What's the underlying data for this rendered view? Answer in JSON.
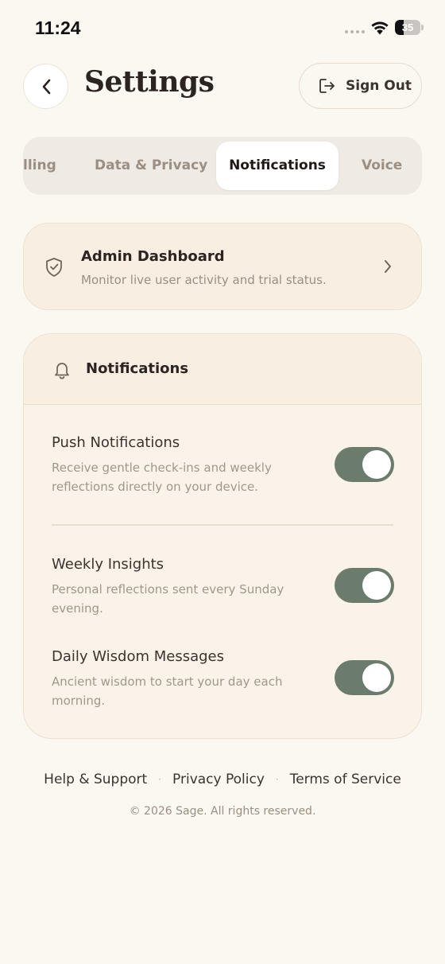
{
  "status_bar": {
    "time": "11:24",
    "battery_level": "35",
    "battery_fraction": 0.35,
    "icons": [
      "signal-dots-icon",
      "wifi-icon",
      "battery-icon"
    ]
  },
  "header": {
    "back_icon": "chevron-left-icon",
    "title": "Settings",
    "sign_out_label": "Sign Out",
    "sign_out_icon": "logout-icon"
  },
  "tabs": {
    "items": [
      {
        "label": "lling",
        "active": false
      },
      {
        "label": "Data & Privacy",
        "active": false
      },
      {
        "label": "Notifications",
        "active": true
      },
      {
        "label": "Voice",
        "active": false
      }
    ]
  },
  "admin_card": {
    "icon": "shield-check-icon",
    "title": "Admin Dashboard",
    "subtitle": "Monitor live user activity and trial status.",
    "chevron": "chevron-right-icon"
  },
  "notifications": {
    "icon": "bell-icon",
    "title": "Notifications",
    "settings": [
      {
        "title": "Push Notifications",
        "description": "Receive gentle check-ins and weekly reflections directly on your device.",
        "enabled": true
      },
      {
        "title": "Weekly Insights",
        "description": "Personal reflections sent every Sunday evening.",
        "enabled": true
      },
      {
        "title": "Daily Wisdom Messages",
        "description": "Ancient wisdom to start your day each morning.",
        "enabled": true
      }
    ]
  },
  "footer": {
    "links": [
      "Help & Support",
      "Privacy Policy",
      "Terms of Service"
    ],
    "separator": "·",
    "copyright": "© 2026 Sage. All rights reserved."
  },
  "colors": {
    "background": "#fbf7f1",
    "card": "#f8eee1",
    "toggle_on": "#6b7c6d",
    "muted_text": "#9a8f85"
  }
}
